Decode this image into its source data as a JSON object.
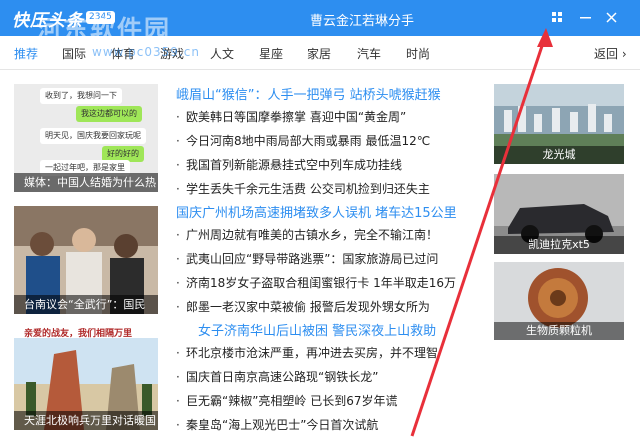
{
  "window": {
    "logo_text": "快压头条",
    "logo_badge": "2345",
    "title": "曹云金江若琳分手",
    "watermark": "河东软件园",
    "watermark_url": "www.pc0359.cn"
  },
  "nav": {
    "items": [
      "推荐",
      "国际",
      "体育",
      "游戏",
      "人文",
      "星座",
      "家居",
      "汽车",
      "时尚"
    ],
    "active_index": 0,
    "back_label": "返回"
  },
  "tiles": [
    {
      "caption": "媒体：中国人结婚为什么热",
      "chat": [
        "收到了，我想问一下",
        "我这边都可以的",
        "明天见，国庆我要回家玩呢",
        "好的好的",
        "一起过年吧，那是家里"
      ]
    },
    {
      "caption": "台南议会“全武行”：国民"
    },
    {
      "caption": "天涯北极响兵万里对话暖国",
      "banner_text": "亲爱的战友，我们相隔万里"
    }
  ],
  "thumbs": [
    {
      "caption": "龙光城"
    },
    {
      "caption": "凯迪拉克xt5"
    },
    {
      "caption": "生物质颗粒机"
    }
  ],
  "news": [
    {
      "type": "headline",
      "text": "峨眉山“猴信”：人手一把弹弓 站桥头唬猴赶猴"
    },
    {
      "type": "item",
      "text": "欧美韩日等国摩拳擦掌 喜迎中国“黄金周”"
    },
    {
      "type": "item",
      "text": "今日河南8地中雨局部大雨或暴雨 最低温12℃"
    },
    {
      "type": "item",
      "text": "我国首列新能源悬挂式空中列车成功挂线"
    },
    {
      "type": "item",
      "text": "学生丢失千余元生活费 公交司机捡到归还失主"
    },
    {
      "type": "headline",
      "text": "国庆广州机场高速拥堵致多人误机 堵车达15公里"
    },
    {
      "type": "item",
      "text": "广州周边就有唯美的古镇水乡，完全不输江南！"
    },
    {
      "type": "item",
      "text": "武夷山回应“野导带路逃票”：国家旅游局已过问"
    },
    {
      "type": "item",
      "text": "济南18岁女子盗取合租闺蜜银行卡 1年半取走16万"
    },
    {
      "type": "item",
      "text": "郎墨一老汉家中菜被偷 报警后发现外甥女所为"
    },
    {
      "type": "headline",
      "text": "女子济南华山后山被困 警民深夜上山救助"
    },
    {
      "type": "item",
      "text": "环北京楼市沧沫严重，再冲进去买房，并不理智"
    },
    {
      "type": "item",
      "text": "国庆首日南京高速公路现“钢铁长龙”"
    },
    {
      "type": "item",
      "text": "巨无霸“辣椒”亮相塑岭 已长到67岁年谎"
    },
    {
      "type": "item",
      "text": "秦皇岛“海上观光巴士”今日首次试航"
    }
  ],
  "colors": {
    "accent": "#2d8ef0",
    "arrow": "#e8303a"
  }
}
